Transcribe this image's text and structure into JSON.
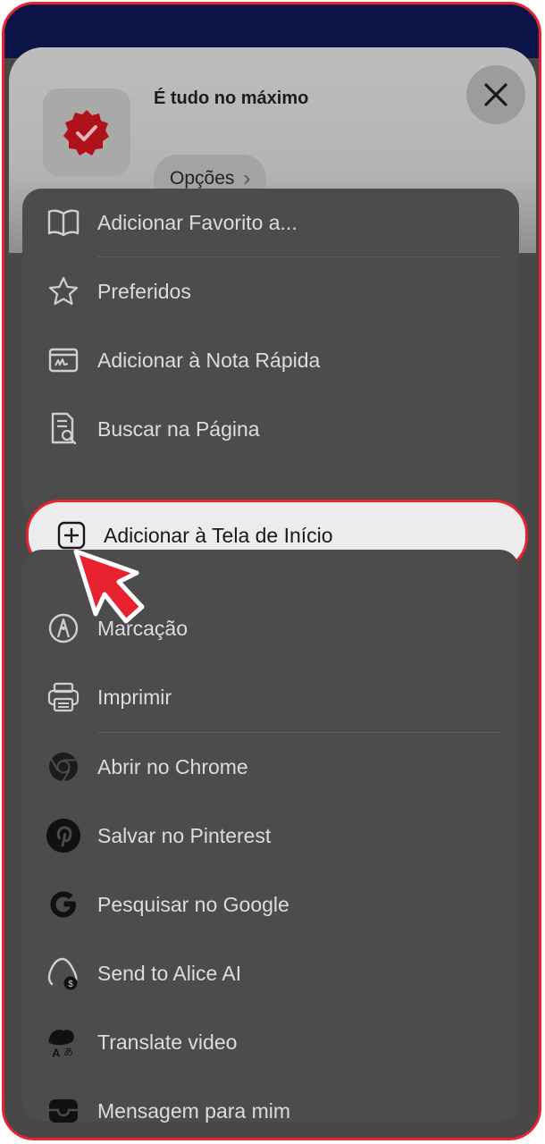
{
  "header": {
    "site_title": "É tudo no máximo",
    "options_label": "Opções",
    "options_chevron": "›",
    "close_icon": "close-icon",
    "site_icon": "verified-badge-icon"
  },
  "menu": {
    "group1": [
      {
        "label": "Adicionar Favorito a...",
        "icon": "book-icon"
      },
      {
        "label": "Preferidos",
        "icon": "star-icon"
      },
      {
        "label": "Adicionar à Nota Rápida",
        "icon": "quick-note-icon"
      },
      {
        "label": "Buscar na Página",
        "icon": "find-in-page-icon"
      }
    ],
    "highlighted": {
      "label": "Adicionar à Tela de Início",
      "icon": "add-square-icon"
    },
    "group2": [
      {
        "label": "Marcação",
        "icon": "markup-pen-icon"
      },
      {
        "label": "Imprimir",
        "icon": "printer-icon"
      },
      {
        "label": "Abrir no Chrome",
        "icon": "chrome-icon"
      },
      {
        "label": "Salvar no Pinterest",
        "icon": "pinterest-icon"
      },
      {
        "label": "Pesquisar no Google",
        "icon": "google-icon"
      },
      {
        "label": "Send to Alice AI",
        "icon": "alice-ai-icon"
      },
      {
        "label": "Translate video",
        "icon": "translate-video-icon"
      },
      {
        "label": "Mensagem para mim",
        "icon": "message-tray-icon"
      }
    ]
  },
  "colors": {
    "highlight_border": "#e8222e",
    "pointer_arrow": "#e8222e",
    "badge": "#b0121b"
  },
  "pointer": {
    "icon": "pointer-arrow-icon"
  }
}
